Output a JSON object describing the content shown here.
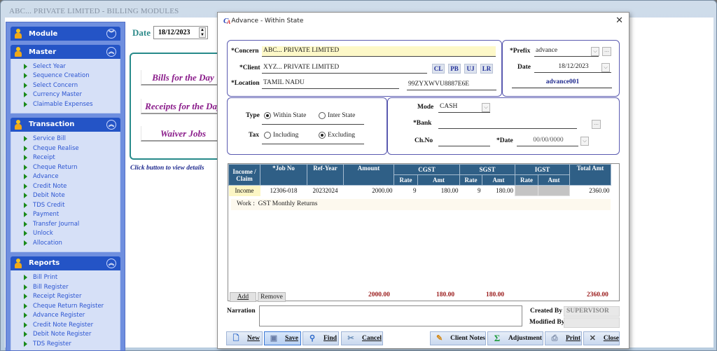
{
  "app": {
    "title": "ABC... PRIVATE LIMITED - BILLING MODULES"
  },
  "sidebar": {
    "panels": [
      {
        "label": "Module",
        "state": "collapsed",
        "toggle_glyph": "⌄",
        "items": []
      },
      {
        "label": "Master",
        "state": "expanded",
        "toggle_glyph": "⌃",
        "items": [
          "Select Year",
          "Sequence Creation",
          "Select Concern",
          "Currency Master",
          "Claimable Expenses"
        ]
      },
      {
        "label": "Transaction",
        "state": "expanded",
        "toggle_glyph": "⌃",
        "items": [
          "Service Bill",
          "Cheque Realise",
          "Receipt",
          "Cheque Return",
          "Advance",
          "Credit Note",
          "Debit Note",
          "TDS Credit",
          "Payment",
          "Transfer Journal",
          "Unlock",
          "Allocation"
        ]
      },
      {
        "label": "Reports",
        "state": "expanded",
        "toggle_glyph": "⌃",
        "items": [
          "Bill Print",
          "Bill Register",
          "Receipt Register",
          "Cheque Return Register",
          "Advance Register",
          "Credit Note Register",
          "Debit Note Register",
          "TDS Register"
        ]
      }
    ]
  },
  "main": {
    "date_label": "Date",
    "date_value": "18/12/2023",
    "day_buttons": [
      "Bills for the Day",
      "Receipts for the Day",
      "Waiver Jobs"
    ],
    "hint": "Click button to view details"
  },
  "dialog": {
    "title": "Advance - Within State",
    "close_glyph": "✕",
    "header": {
      "concern_label": "*Concern",
      "concern_value": "ABC... PRIVATE LIMITED",
      "client_label": "*Client",
      "client_value": "XYZ... PRIVATE LIMITED",
      "client_buttons": [
        "CL",
        "PB",
        "UJ",
        "LR"
      ],
      "location_label": "*Location",
      "location_value": "TAMIL NADU",
      "gstin_value": "99ZYXWVU8887E6E",
      "prefix_label": "*Prefix",
      "prefix_value": "advance",
      "date_label": "Date",
      "date_value": "18/12/2023",
      "doc_no": "advance001"
    },
    "type": {
      "type_label": "Type",
      "type_options": [
        {
          "label": "Within State",
          "selected": true
        },
        {
          "label": "Inter State",
          "selected": false
        }
      ],
      "tax_label": "Tax",
      "tax_options": [
        {
          "label": "Including",
          "selected": false
        },
        {
          "label": "Excluding",
          "selected": true
        }
      ]
    },
    "payment": {
      "mode_label": "Mode",
      "mode_value": "CASH",
      "bank_label": "*Bank",
      "bank_value": "",
      "chno_label": "Ch.No",
      "chno_value": "",
      "date_label": "*Date",
      "date_value": "00/00/0000"
    },
    "grid": {
      "headers": {
        "income_claim": "Income / Claim",
        "job_no": "*Job No",
        "ref_year": "Ref-Year",
        "amount": "Amount",
        "cgst": "CGST",
        "sgst": "SGST",
        "igst": "IGST",
        "total": "Total Amt",
        "rate": "Rate",
        "amt": "Amt"
      },
      "rows": [
        {
          "type": "Income",
          "job_no": "12306-018",
          "ref_year": "20232024",
          "amount": "2000.00",
          "cgst_rate": "9",
          "cgst_amt": "180.00",
          "sgst_rate": "9",
          "sgst_amt": "180.00",
          "igst_rate": "",
          "igst_amt": "",
          "total": "2360.00"
        }
      ],
      "work_label": "Work :",
      "work_value": "GST Monthly Returns",
      "add_label": "Add",
      "remove_label": "Remove",
      "totals": {
        "amount": "2000.00",
        "cgst": "180.00",
        "sgst": "180.00",
        "total": "2360.00"
      }
    },
    "narration_label": "Narration",
    "narration_value": "",
    "created_by_label": "Created By",
    "created_by_value": "SUPERVISOR",
    "modified_by_label": "Modified By",
    "modified_by_value": "",
    "footer_buttons": [
      {
        "key": "new",
        "label": "New",
        "icon": "new-doc-icon"
      },
      {
        "key": "save",
        "label": "Save",
        "icon": "save-icon"
      },
      {
        "key": "find",
        "label": "Find",
        "icon": "find-icon"
      },
      {
        "key": "cancel",
        "label": "Cancel",
        "icon": "cancel-icon"
      },
      {
        "key": "client_notes",
        "label": "Client Notes",
        "icon": "notes-icon"
      },
      {
        "key": "adjustment",
        "label": "Adjustment",
        "icon": "sigma-icon"
      },
      {
        "key": "print",
        "label": "Print",
        "icon": "print-icon"
      },
      {
        "key": "close",
        "label": "Close",
        "icon": "close-icon"
      }
    ]
  }
}
